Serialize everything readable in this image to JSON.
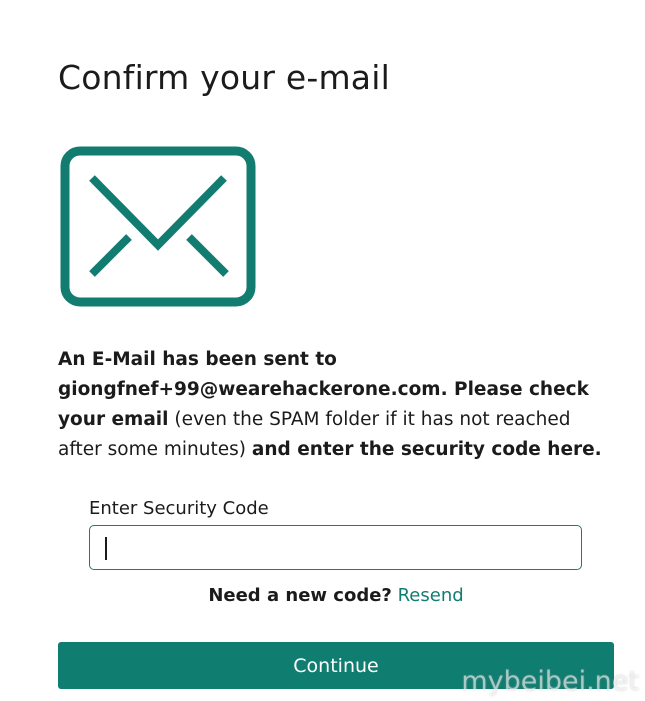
{
  "title": "Confirm your e-mail",
  "icon": "mail-envelope-icon",
  "colors": {
    "accent": "#107d71",
    "text": "#1b1b1b"
  },
  "message": {
    "part1_bold": "An E-Mail has been sent to giongfnef+99@wearehackerone.com. Please check your email",
    "part2": " (even the SPAM folder if it has not reached after some minutes) ",
    "part3_bold": "and enter the security code here."
  },
  "security_code": {
    "label": "Enter Security Code",
    "value": "",
    "placeholder": ""
  },
  "resend": {
    "question": "Need a new code?",
    "link": "Resend"
  },
  "continue_label": "Continue",
  "watermark": "mybeibei.net"
}
